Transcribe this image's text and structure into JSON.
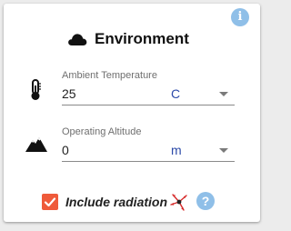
{
  "card": {
    "title": "Environment",
    "title_icon": "cloud-icon",
    "info_icon": "info-icon",
    "info_glyph": "i"
  },
  "fields": [
    {
      "label": "Ambient Temperature",
      "value": "25",
      "unit": "C",
      "icon": "thermometer-icon"
    },
    {
      "label": "Operating Altitude",
      "value": "0",
      "unit": "m",
      "icon": "mountain-icon"
    }
  ],
  "radiation": {
    "label": "Include radiation",
    "checked": true,
    "icon": "radiation-arrows-icon",
    "help_glyph": "?",
    "help_icon": "help-icon"
  },
  "colors": {
    "checkbox": "#ef5a3a",
    "info_button": "#8fbfe8",
    "unit_text": "#2c4aa8",
    "radiation_arrows": "#d62a2a"
  }
}
